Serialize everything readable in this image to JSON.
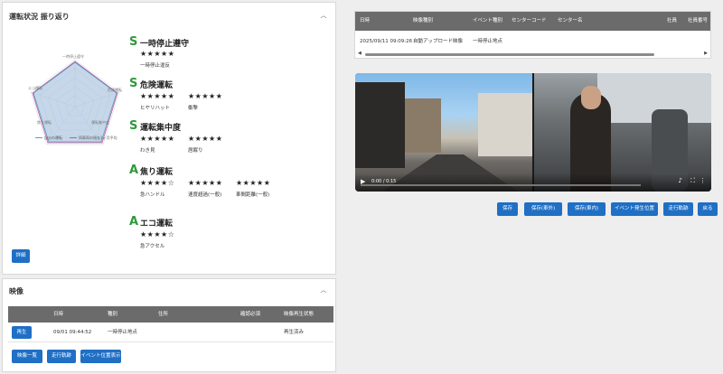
{
  "review": {
    "title": "運転状況 振り返り",
    "detail_button": "詳細",
    "legend": {
      "self": "自分の運転",
      "avg": "同車両の過去1ヶ月平均"
    },
    "radar_axes": [
      "一時停止遵守",
      "危険運転",
      "運転集中度",
      "焦り運転",
      "エコ運転"
    ],
    "categories": [
      {
        "grade": "S",
        "name": "一時停止遵守",
        "items": [
          {
            "stars": "★★★★★",
            "label": "一時停止違反"
          }
        ]
      },
      {
        "grade": "S",
        "name": "危険運転",
        "items": [
          {
            "stars": "★★★★★",
            "label": "ヒヤリハット"
          },
          {
            "stars": "★★★★★",
            "label": "衝撃"
          }
        ]
      },
      {
        "grade": "S",
        "name": "運転集中度",
        "items": [
          {
            "stars": "★★★★★",
            "label": "わき見"
          },
          {
            "stars": "★★★★★",
            "label": "居眠り"
          }
        ]
      },
      {
        "grade": "A",
        "name": "焦り運転",
        "items": [
          {
            "stars": "★★★★☆",
            "label": "急ハンドル"
          },
          {
            "stars": "★★★★★",
            "label": "速度超過(一般)"
          },
          {
            "stars": "★★★★★",
            "label": "車間距離(一般)"
          }
        ]
      },
      {
        "grade": "A",
        "name": "エコ運転",
        "items": [
          {
            "stars": "★★★★☆",
            "label": "急アクセル"
          }
        ]
      }
    ]
  },
  "video": {
    "title": "映像",
    "headers": [
      "日時",
      "種別",
      "住所",
      "確認必須",
      "映像再生状態"
    ],
    "rows": [
      {
        "action": "再生",
        "datetime": "09/01 09:44:52",
        "type": "一時停止地点",
        "address": "",
        "required": "",
        "status": "再生済み"
      }
    ],
    "buttons": [
      "映像一覧",
      "走行軌跡",
      "イベント位置表示"
    ]
  },
  "events": {
    "headers": [
      "日時",
      "映像種別",
      "イベント種別",
      "センターコード",
      "センター名",
      "社員",
      "社員番号"
    ],
    "rows": [
      {
        "datetime": "2025/09/11 09:09:26",
        "video_type": "自動アップロード映像",
        "event_type": "一時停止地点"
      }
    ]
  },
  "player": {
    "time": "0:00 / 0:15",
    "progress": 0.0
  },
  "player_buttons": [
    "保存",
    "保存(車外)",
    "保存(車内)",
    "イベント発生位置",
    "走行軌跡",
    "戻る"
  ],
  "colors": {
    "accent": "#1f6fc5",
    "grade": "#2e9a3a",
    "header": "#6b6b6b"
  }
}
